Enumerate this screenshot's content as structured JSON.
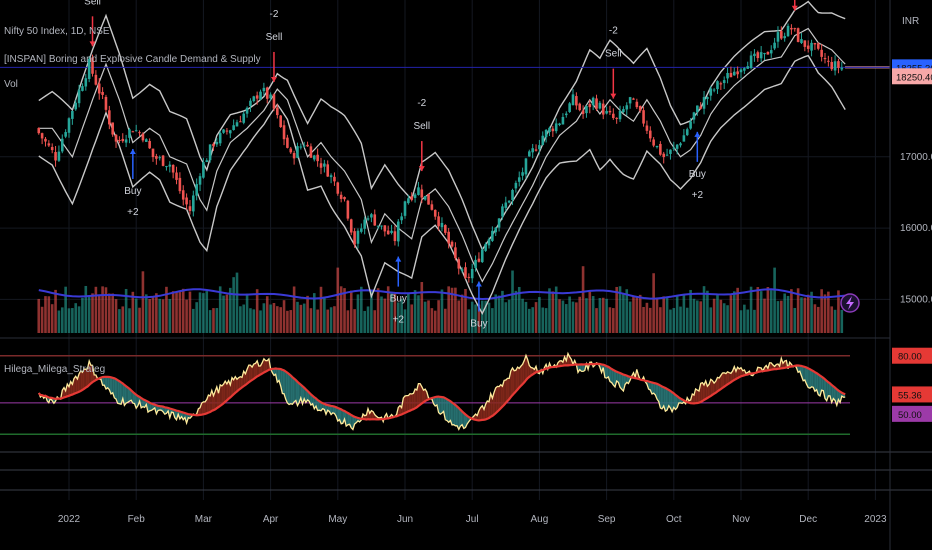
{
  "header": {
    "symbol": "Nifty 50 Index, 1D, NSE",
    "indicator": "[INSPAN] Boring and Explosive Candle Demand & Supply",
    "vol_label": "Vol",
    "currency": "INR",
    "oscillator": "Hilega_Milega_Strateg"
  },
  "colors": {
    "background": "#000000",
    "up": "#26a69a",
    "down": "#ef5350",
    "band": "#c8c8c8",
    "vol_ma": "#3a3ad6",
    "osc_fast": "#ffeb9c",
    "osc_slow": "#e53935",
    "fill_red": "#8b2a1c",
    "fill_teal": "#2a7a7a",
    "level_hi": "#7a2a2a",
    "level_lo": "#1f6b2c",
    "level_mid": "#9c3aa8",
    "badge_blue": "#2962ff",
    "badge_pink": "#f7a8a8"
  },
  "chart_data": [
    {
      "type": "candlestick",
      "ylim": [
        14500,
        19200
      ],
      "y_ticks": [
        "17000.00",
        "16000.00",
        "15000.00"
      ],
      "y_tick_values": [
        17000,
        16000,
        15000
      ],
      "x_ticks": [
        "2022",
        "Feb",
        "Mar",
        "Apr",
        "May",
        "Jun",
        "Jul",
        "Aug",
        "Sep",
        "Oct",
        "Nov",
        "Dec",
        "2023"
      ],
      "x_tick_months": [
        0,
        1,
        2,
        3,
        4,
        5,
        6,
        7,
        8,
        9,
        10,
        11,
        12
      ],
      "start_month": -0.45,
      "end_month": 11.55,
      "price_path": [
        [
          -0.45,
          17400
        ],
        [
          -0.3,
          17200
        ],
        [
          -0.15,
          17000
        ],
        [
          0.0,
          17400
        ],
        [
          0.15,
          17800
        ],
        [
          0.35,
          18300
        ],
        [
          0.55,
          17800
        ],
        [
          0.75,
          17200
        ],
        [
          1.0,
          17400
        ],
        [
          1.15,
          17300
        ],
        [
          1.3,
          17000
        ],
        [
          1.55,
          16900
        ],
        [
          1.75,
          16400
        ],
        [
          1.85,
          16250
        ],
        [
          2.0,
          16800
        ],
        [
          2.2,
          17200
        ],
        [
          2.45,
          17400
        ],
        [
          2.7,
          17650
        ],
        [
          2.9,
          17950
        ],
        [
          3.05,
          17800
        ],
        [
          3.2,
          17400
        ],
        [
          3.35,
          17000
        ],
        [
          3.55,
          17200
        ],
        [
          3.7,
          17000
        ],
        [
          3.9,
          16800
        ],
        [
          4.15,
          16400
        ],
        [
          4.3,
          15800
        ],
        [
          4.5,
          16200
        ],
        [
          4.7,
          16000
        ],
        [
          4.9,
          15850
        ],
        [
          5.05,
          16400
        ],
        [
          5.25,
          16550
        ],
        [
          5.45,
          16300
        ],
        [
          5.65,
          15900
        ],
        [
          5.8,
          15550
        ],
        [
          5.95,
          15250
        ],
        [
          6.1,
          15500
        ],
        [
          6.3,
          15900
        ],
        [
          6.5,
          16250
        ],
        [
          6.7,
          16600
        ],
        [
          6.9,
          17000
        ],
        [
          7.1,
          17300
        ],
        [
          7.35,
          17500
        ],
        [
          7.55,
          17800
        ],
        [
          7.7,
          17600
        ],
        [
          7.85,
          17800
        ],
        [
          8.05,
          17600
        ],
        [
          8.2,
          17500
        ],
        [
          8.4,
          17800
        ],
        [
          8.6,
          17500
        ],
        [
          8.75,
          17200
        ],
        [
          8.9,
          17000
        ],
        [
          9.05,
          17100
        ],
        [
          9.2,
          17300
        ],
        [
          9.35,
          17600
        ],
        [
          9.5,
          17800
        ],
        [
          9.7,
          18000
        ],
        [
          9.95,
          18200
        ],
        [
          10.15,
          18350
        ],
        [
          10.4,
          18400
        ],
        [
          10.6,
          18700
        ],
        [
          10.8,
          18800
        ],
        [
          10.95,
          18600
        ],
        [
          11.15,
          18500
        ],
        [
          11.35,
          18300
        ],
        [
          11.55,
          18250
        ]
      ],
      "last_price": "18255.30",
      "other_price": "18250.40",
      "last_price_value": 18255,
      "other_price_value": 18130,
      "signals": [
        {
          "kind": "sell",
          "month": 0.35,
          "labels": [
            "Sell"
          ]
        },
        {
          "kind": "buy",
          "month": 0.95,
          "labels": [
            "Buy",
            "+2"
          ]
        },
        {
          "kind": "sell",
          "month": 3.05,
          "labels": [
            "-2",
            "Sell"
          ]
        },
        {
          "kind": "sell",
          "month": 5.25,
          "labels": [
            "-2",
            "Sell"
          ]
        },
        {
          "kind": "buy",
          "month": 4.9,
          "labels": [
            "Buy",
            "+2"
          ]
        },
        {
          "kind": "buy",
          "month": 6.1,
          "labels": [
            "Buy"
          ]
        },
        {
          "kind": "sell",
          "month": 8.1,
          "labels": [
            "-2",
            "Sell"
          ]
        },
        {
          "kind": "buy",
          "month": 9.35,
          "labels": [
            "Buy",
            "+2"
          ]
        },
        {
          "kind": "sell",
          "month": 10.8,
          "labels": []
        }
      ]
    },
    {
      "type": "bar",
      "name": "Vol",
      "volume_ma_level": 0.6
    },
    {
      "type": "line",
      "name": "Hilega_Milega_Strateg",
      "ylim": [
        20,
        90
      ],
      "levels": [
        80.0,
        55.36,
        50.0
      ],
      "level_labels": [
        "80.00",
        "55.36",
        "50.00"
      ],
      "lower_level": 30,
      "osc_path": [
        [
          -0.45,
          55
        ],
        [
          -0.2,
          50
        ],
        [
          0.0,
          62
        ],
        [
          0.3,
          75
        ],
        [
          0.5,
          62
        ],
        [
          0.7,
          52
        ],
        [
          0.9,
          50
        ],
        [
          1.1,
          48
        ],
        [
          1.3,
          44
        ],
        [
          1.55,
          42
        ],
        [
          1.8,
          38
        ],
        [
          2.0,
          52
        ],
        [
          2.2,
          58
        ],
        [
          2.5,
          66
        ],
        [
          2.75,
          74
        ],
        [
          2.95,
          78
        ],
        [
          3.15,
          60
        ],
        [
          3.3,
          48
        ],
        [
          3.5,
          52
        ],
        [
          3.75,
          45
        ],
        [
          4.0,
          40
        ],
        [
          4.25,
          35
        ],
        [
          4.45,
          46
        ],
        [
          4.65,
          40
        ],
        [
          4.85,
          42
        ],
        [
          5.05,
          56
        ],
        [
          5.25,
          62
        ],
        [
          5.5,
          46
        ],
        [
          5.7,
          36
        ],
        [
          5.9,
          34
        ],
        [
          6.1,
          44
        ],
        [
          6.35,
          58
        ],
        [
          6.55,
          68
        ],
        [
          6.8,
          78
        ],
        [
          7.0,
          70
        ],
        [
          7.2,
          74
        ],
        [
          7.45,
          80
        ],
        [
          7.6,
          70
        ],
        [
          7.85,
          76
        ],
        [
          8.05,
          64
        ],
        [
          8.25,
          60
        ],
        [
          8.45,
          70
        ],
        [
          8.65,
          58
        ],
        [
          8.8,
          48
        ],
        [
          9.0,
          46
        ],
        [
          9.2,
          52
        ],
        [
          9.45,
          62
        ],
        [
          9.7,
          66
        ],
        [
          9.95,
          72
        ],
        [
          10.15,
          68
        ],
        [
          10.4,
          74
        ],
        [
          10.6,
          76
        ],
        [
          10.8,
          72
        ],
        [
          11.0,
          62
        ],
        [
          11.2,
          56
        ],
        [
          11.4,
          50
        ],
        [
          11.55,
          54
        ]
      ]
    }
  ]
}
